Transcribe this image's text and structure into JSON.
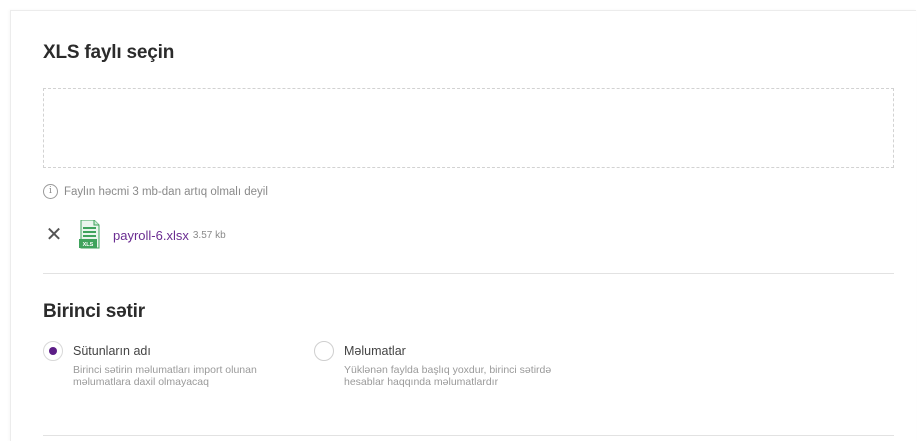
{
  "upload": {
    "title": "XLS faylı seçin",
    "hint": "Faylın həcmi 3 mb-dan artıq olmalı deyil",
    "info_icon": "i",
    "file": {
      "name": "payroll-6.xlsx",
      "size": "3.57 kb",
      "icon_badge": "XLS",
      "remove_glyph": "✕"
    }
  },
  "first_row": {
    "title": "Birinci sətir",
    "options": [
      {
        "label": "Sütunların adı",
        "description": "Birinci sətirin məlumatları import olunan məlumatlara daxil olmayacaq",
        "selected": true
      },
      {
        "label": "Məlumatlar",
        "description": "Yüklənən faylda başlıq yoxdur, birinci sətirdə hesablar haqqında məlumatlardır",
        "selected": false
      }
    ]
  },
  "colors": {
    "accent": "#5c1d86",
    "file_link": "#6a2c91",
    "xls_green": "#3fa35c"
  }
}
